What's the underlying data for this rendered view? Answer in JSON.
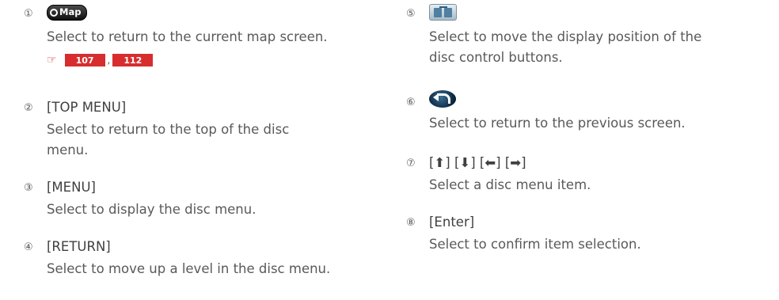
{
  "items": [
    {
      "num": "①",
      "icon": "map-button",
      "icon_label": "Map",
      "desc": [
        "Select to return to the current map screen."
      ],
      "refs": {
        "pages": [
          "107",
          "112"
        ],
        "separator": ","
      }
    },
    {
      "num": "②",
      "heading": "[TOP MENU]",
      "desc": [
        "Select to return to the top of the disc",
        "menu."
      ]
    },
    {
      "num": "③",
      "heading": "[MENU]",
      "desc": [
        "Select to display the disc menu."
      ]
    },
    {
      "num": "④",
      "heading": "[RETURN]",
      "desc": [
        "Select to move up a level in the disc menu."
      ]
    },
    {
      "num": "⑤",
      "icon": "display-position-icon",
      "desc": [
        "Select to move the display position of the",
        "disc control buttons."
      ]
    },
    {
      "num": "⑥",
      "icon": "back-arrow-icon",
      "desc": [
        "Select to return to the previous screen."
      ]
    },
    {
      "num": "⑦",
      "heading": "[⬆] [⬇] [⬅] [➡]",
      "desc": [
        "Select a disc menu item."
      ]
    },
    {
      "num": "⑧",
      "heading": "[Enter]",
      "desc": [
        "Select to confirm item selection."
      ]
    }
  ],
  "colors": {
    "text": "#58595b",
    "reference_red": "#d72d2f"
  }
}
